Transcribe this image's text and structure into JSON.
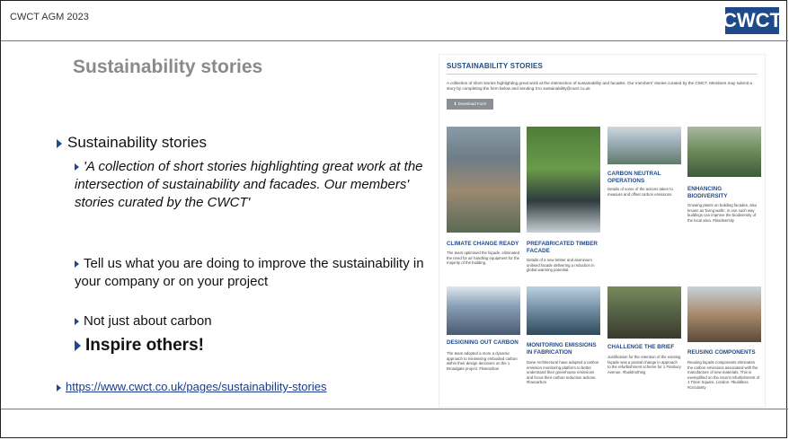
{
  "header": {
    "title": "CWCT AGM 2023",
    "logo_text": "CWCT"
  },
  "slide": {
    "heading": "Sustainability stories",
    "bullet_main": "Sustainability stories",
    "bullet_quote": "'A collection of short stories highlighting great work at the intersection of sustainability and facades. Our members' stories curated by the CWCT'",
    "bullet_tellus": "Tell us what you are doing to improve the sustainability in your company or on your project",
    "bullet_carbon": "Not just about carbon",
    "bullet_inspire": "Inspire others!",
    "link": "https://www.cwct.co.uk/pages/sustainability-stories"
  },
  "panel": {
    "title": "SUSTAINABILITY STORIES",
    "description": "A collection of short stories highlighting great work at the intersection of sustainability and facades. Our members' stories curated by the CWCT. Members may submit a story by completing the form below and sending it to sustainability@cwct.co.uk",
    "download_label": "⬇ Download Form",
    "cards": [
      {
        "title": "CLIMATE CHANGE READY",
        "desc": "The team optimised the façade, eliminated the need for air handling equipment for the majority of the building."
      },
      {
        "title": "PREFABRICATED TIMBER FACADE",
        "desc": "Details of a new timber and aluminium unitised facade delivering a reduction in global warming potential."
      },
      {
        "title": "CARBON NEUTRAL OPERATIONS",
        "desc": "Details of some of the actions taken to measure and offset carbon emissions."
      },
      {
        "title": "ENHANCING BIODIVERSITY",
        "desc": "Growing plants on building facades, also known as 'living walls', is one such way buildings can improve the biodiversity of the local area. #biodiversity"
      },
      {
        "title": "DESIGNING OUT CARBON",
        "desc": "The team adopted a more a dynamic approach to minimising embodied carbon within their design decisions on the 1 Broadgate project. #lowcarbon"
      },
      {
        "title": "MONITORING EMISSIONS IN FABRICATION",
        "desc": "Dane Architectural have adopted a carbon emission monitoring platform to better understand their greenhouse emissions and focus their carbon reduction actions. #lowcarbon"
      },
      {
        "title": "CHALLENGE THE BRIEF",
        "desc": "Justification for the retention of the existing façade was a pivotal change in approach to the refurbishment scheme for 1 Finsbury Avenue. #buildnothing"
      },
      {
        "title": "REUSING COMPONENTS",
        "desc": "Reusing façade components eliminates the carbon emissions associated with the manufacture of new materials. This is exemplified on the recent refurbishment of 1 Triton Square, London. #buildless #circularity"
      }
    ]
  }
}
